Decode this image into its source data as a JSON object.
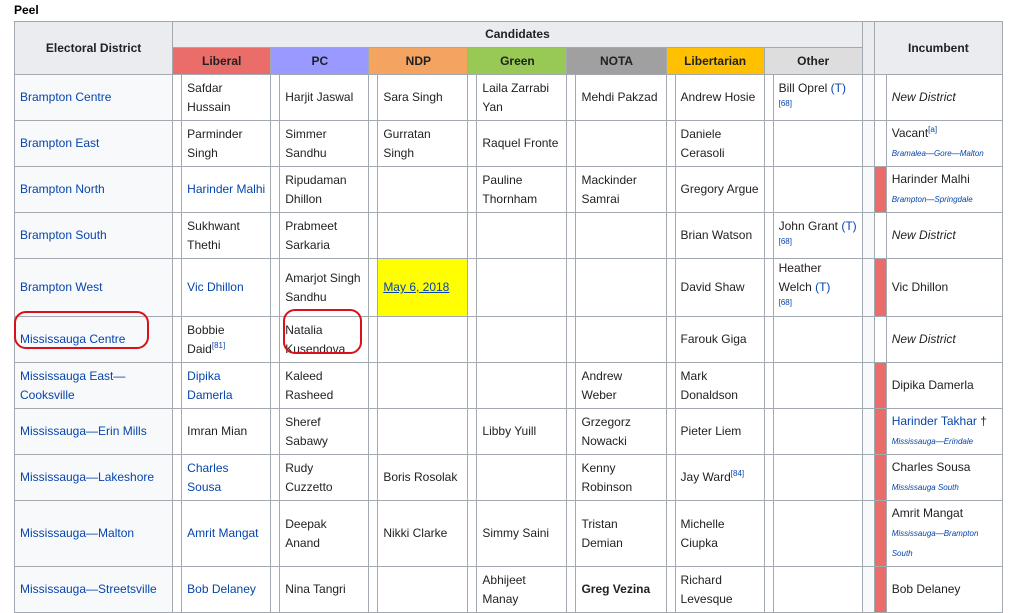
{
  "page": {
    "title": "Peel"
  },
  "headers": {
    "district": "Electoral District",
    "candidates": "Candidates",
    "incumbent": "Incumbent",
    "parties": [
      {
        "label": "Liberal",
        "color": "#ea6d6a"
      },
      {
        "label": "PC",
        "color": "#9999ff"
      },
      {
        "label": "NDP",
        "color": "#f4a460"
      },
      {
        "label": "Green",
        "color": "#99c955"
      },
      {
        "label": "NOTA",
        "color": "#a0a0a0"
      },
      {
        "label": "Libertarian",
        "color": "#ffc000"
      },
      {
        "label": "Other",
        "color": "#dddddd"
      }
    ]
  },
  "colors": {
    "incumbent_liberal_bar": "#ea6d6a",
    "ndp_highlight": "#ffff00",
    "annotation_circle": "#d9101a"
  },
  "rows": [
    {
      "district": "Brampton Centre",
      "liberal": "Safdar Hussain",
      "pc": "Harjit Jaswal",
      "ndp": "Sara Singh",
      "green": "Laila Zarrabi Yan",
      "nota": "Mehdi Pakzad",
      "libertarian": "Andrew Hosie",
      "other": "Bill Oprel",
      "other_tag": "(T)",
      "other_ref": "[68]",
      "incumbent": "New District"
    },
    {
      "district": "Brampton East",
      "liberal": "Parminder Singh",
      "pc": "Simmer Sandhu",
      "ndp": "Gurratan Singh",
      "green": "Raquel Fronte",
      "nota": "",
      "libertarian": "Daniele Cerasoli",
      "other": "",
      "incumbent": "Vacant",
      "incumbent_ref": "[a]",
      "incumbent_sub": "Bramalea—Gore—Malton"
    },
    {
      "district": "Brampton North",
      "liberal": "Harinder Malhi",
      "pc": "Ripudaman Dhillon",
      "ndp": "",
      "green": "Pauline Thornham",
      "nota": "Mackinder Samrai",
      "libertarian": "Gregory Argue",
      "other": "",
      "incumbent": "Harinder Malhi",
      "incumbent_sub": "Brampton—Springdale"
    },
    {
      "district": "Brampton South",
      "liberal": "Sukhwant Thethi",
      "pc": "Prabmeet Sarkaria",
      "ndp": "",
      "green": "",
      "nota": "",
      "libertarian": "Brian Watson",
      "other": "John Grant",
      "other_tag": "(T)",
      "other_ref": "[68]",
      "incumbent": "New District"
    },
    {
      "district": "Brampton West",
      "liberal": "Vic Dhillon",
      "pc": "Amarjot Singh Sandhu",
      "ndp": "May 6, 2018",
      "green": "",
      "nota": "",
      "libertarian": "David Shaw",
      "other": "Heather Welch",
      "other_tag": "(T)",
      "other_ref": "[68]",
      "incumbent": "Vic Dhillon"
    },
    {
      "district": "Mississauga Centre",
      "liberal": "Bobbie Daid",
      "liberal_ref": "[81]",
      "pc": "Natalia Kusendova",
      "ndp": "",
      "green": "",
      "nota": "",
      "libertarian": "Farouk Giga",
      "other": "",
      "incumbent": "New District"
    },
    {
      "district": "Mississauga East—Cooksville",
      "liberal": "Dipika Damerla",
      "pc": "Kaleed Rasheed",
      "ndp": "",
      "green": "",
      "nota": "Andrew Weber",
      "libertarian": "Mark Donaldson",
      "other": "",
      "incumbent": "Dipika Damerla"
    },
    {
      "district": "Mississauga—Erin Mills",
      "liberal": "Imran Mian",
      "pc": "Sheref Sabawy",
      "ndp": "",
      "green": "Libby Yuill",
      "nota": "Grzegorz Nowacki",
      "libertarian": "Pieter Liem",
      "other": "",
      "incumbent": "Harinder Takhar",
      "incumbent_mark": "†",
      "incumbent_sub": "Mississauga—Erindale"
    },
    {
      "district": "Mississauga—Lakeshore",
      "liberal": "Charles Sousa",
      "pc": "Rudy Cuzzetto",
      "ndp": "Boris Rosolak",
      "green": "",
      "nota": "Kenny Robinson",
      "libertarian": "Jay Ward",
      "libertarian_ref": "[84]",
      "other": "",
      "incumbent": "Charles Sousa",
      "incumbent_sub": "Mississauga South"
    },
    {
      "district": "Mississauga—Malton",
      "liberal": "Amrit Mangat",
      "pc": "Deepak Anand",
      "ndp": "Nikki Clarke",
      "green": "Simmy Saini",
      "nota": "Tristan Demian",
      "libertarian": "Michelle Ciupka",
      "other": "",
      "incumbent": "Amrit Mangat",
      "incumbent_sub": "Mississauga—Brampton South"
    },
    {
      "district": "Mississauga—Streetsville",
      "liberal": "Bob Delaney",
      "pc": "Nina Tangri",
      "ndp": "",
      "green": "Abhijeet Manay",
      "nota": "Greg Vezina",
      "libertarian": "Richard Levesque",
      "other": "",
      "incumbent": "Bob Delaney"
    }
  ]
}
